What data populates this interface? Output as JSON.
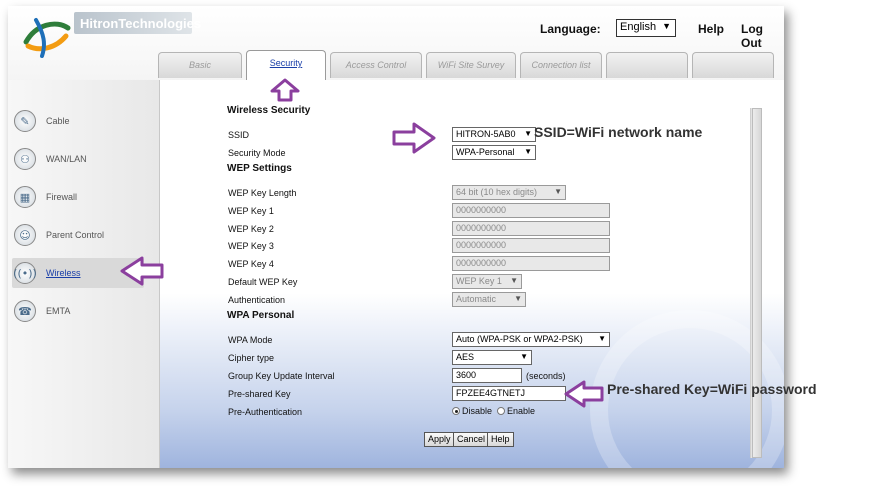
{
  "header": {
    "brand": "HitronTechnologies",
    "language_label": "Language:",
    "language_value": "English",
    "help": "Help",
    "logout": "Log Out"
  },
  "tabs": [
    {
      "label": "Basic"
    },
    {
      "label": "Security"
    },
    {
      "label": "Access Control"
    },
    {
      "label": "WiFi Site Survey"
    },
    {
      "label": "Connection list"
    },
    {
      "label": ""
    },
    {
      "label": ""
    }
  ],
  "sidebar": {
    "items": [
      {
        "label": "Cable",
        "icon": "wrench-icon"
      },
      {
        "label": "WAN/LAN",
        "icon": "network-icon"
      },
      {
        "label": "Firewall",
        "icon": "firewall-icon"
      },
      {
        "label": "Parent Control",
        "icon": "users-icon"
      },
      {
        "label": "Wireless",
        "icon": "wireless-icon"
      },
      {
        "label": "EMTA",
        "icon": "phone-icon"
      }
    ]
  },
  "form": {
    "wireless_security": {
      "heading": "Wireless Security",
      "ssid_label": "SSID",
      "ssid_value": "HITRON-5AB0",
      "security_mode_label": "Security Mode",
      "security_mode_value": "WPA-Personal"
    },
    "wep": {
      "heading": "WEP Settings",
      "key_length_label": "WEP Key Length",
      "key_length_value": "64 bit (10 hex digits)",
      "key1_label": "WEP Key 1",
      "key1_value": "0000000000",
      "key2_label": "WEP Key 2",
      "key2_value": "0000000000",
      "key3_label": "WEP Key 3",
      "key3_value": "0000000000",
      "key4_label": "WEP Key 4",
      "key4_value": "0000000000",
      "default_key_label": "Default WEP Key",
      "default_key_value": "WEP Key 1",
      "auth_label": "Authentication",
      "auth_value": "Automatic"
    },
    "wpa": {
      "heading": "WPA Personal",
      "mode_label": "WPA Mode",
      "mode_value": "Auto (WPA-PSK or WPA2-PSK)",
      "cipher_label": "Cipher type",
      "cipher_value": "AES",
      "interval_label": "Group Key Update Interval",
      "interval_value": "3600",
      "interval_unit": "(seconds)",
      "psk_label": "Pre-shared Key",
      "psk_value": "FPZEE4GTNETJ",
      "preauth_label": "Pre-Authentication",
      "preauth_disable": "Disable",
      "preauth_enable": "Enable"
    },
    "buttons": {
      "apply": "Apply",
      "cancel": "Cancel",
      "help": "Help"
    }
  },
  "annotations": {
    "ssid_note": "SSID=WiFi network name",
    "psk_note": "Pre-shared Key=WiFi password",
    "arrow_color": "#8b3f9e"
  }
}
